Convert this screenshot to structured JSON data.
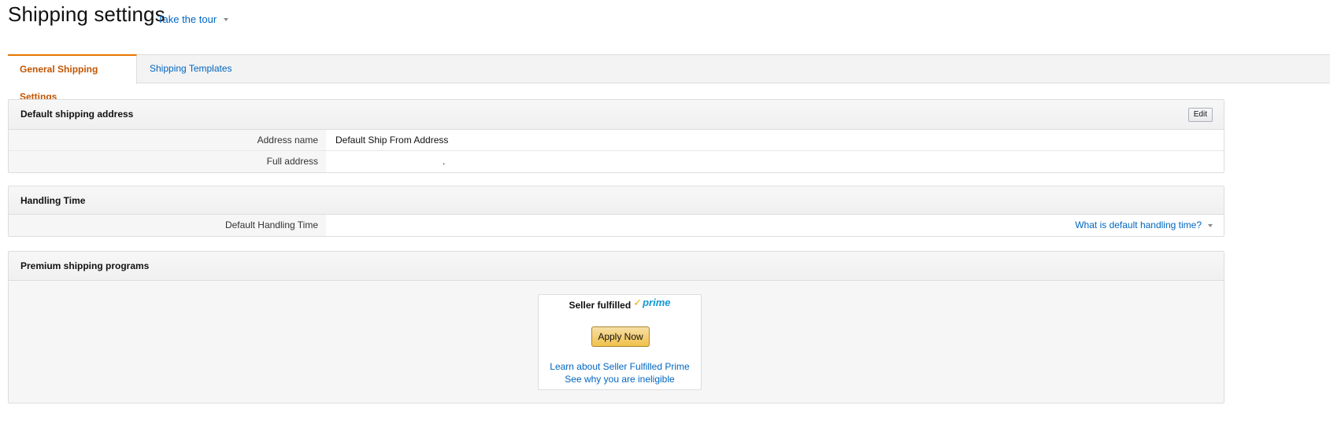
{
  "header": {
    "title": "Shipping settings",
    "tour_link": "Take the tour"
  },
  "tabs": [
    {
      "label": "General Shipping Settings",
      "active": true
    },
    {
      "label": "Shipping Templates",
      "active": false
    }
  ],
  "default_address": {
    "title": "Default shipping address",
    "edit_label": "Edit",
    "rows": [
      {
        "label": "Address name",
        "value": "Default Ship From Address"
      },
      {
        "label": "Full address",
        "value": "."
      }
    ]
  },
  "handling": {
    "title": "Handling Time",
    "rows": [
      {
        "label": "Default Handling Time",
        "value": ""
      }
    ],
    "help_link": "What is default handling time?"
  },
  "premium": {
    "title": "Premium shipping programs",
    "card": {
      "title": "Seller fulfilled",
      "logo_text": "prime",
      "apply_label": "Apply Now",
      "learn_link": "Learn about Seller Fulfilled Prime",
      "ineligible_link": "See why you are ineligible"
    }
  },
  "colors": {
    "link": "#0066c0",
    "active_tab": "#c45500",
    "tab_accent": "#e77600",
    "apply_button": "#f0c14b",
    "prime_blue": "#1399d5",
    "prime_check": "#f2a900"
  }
}
